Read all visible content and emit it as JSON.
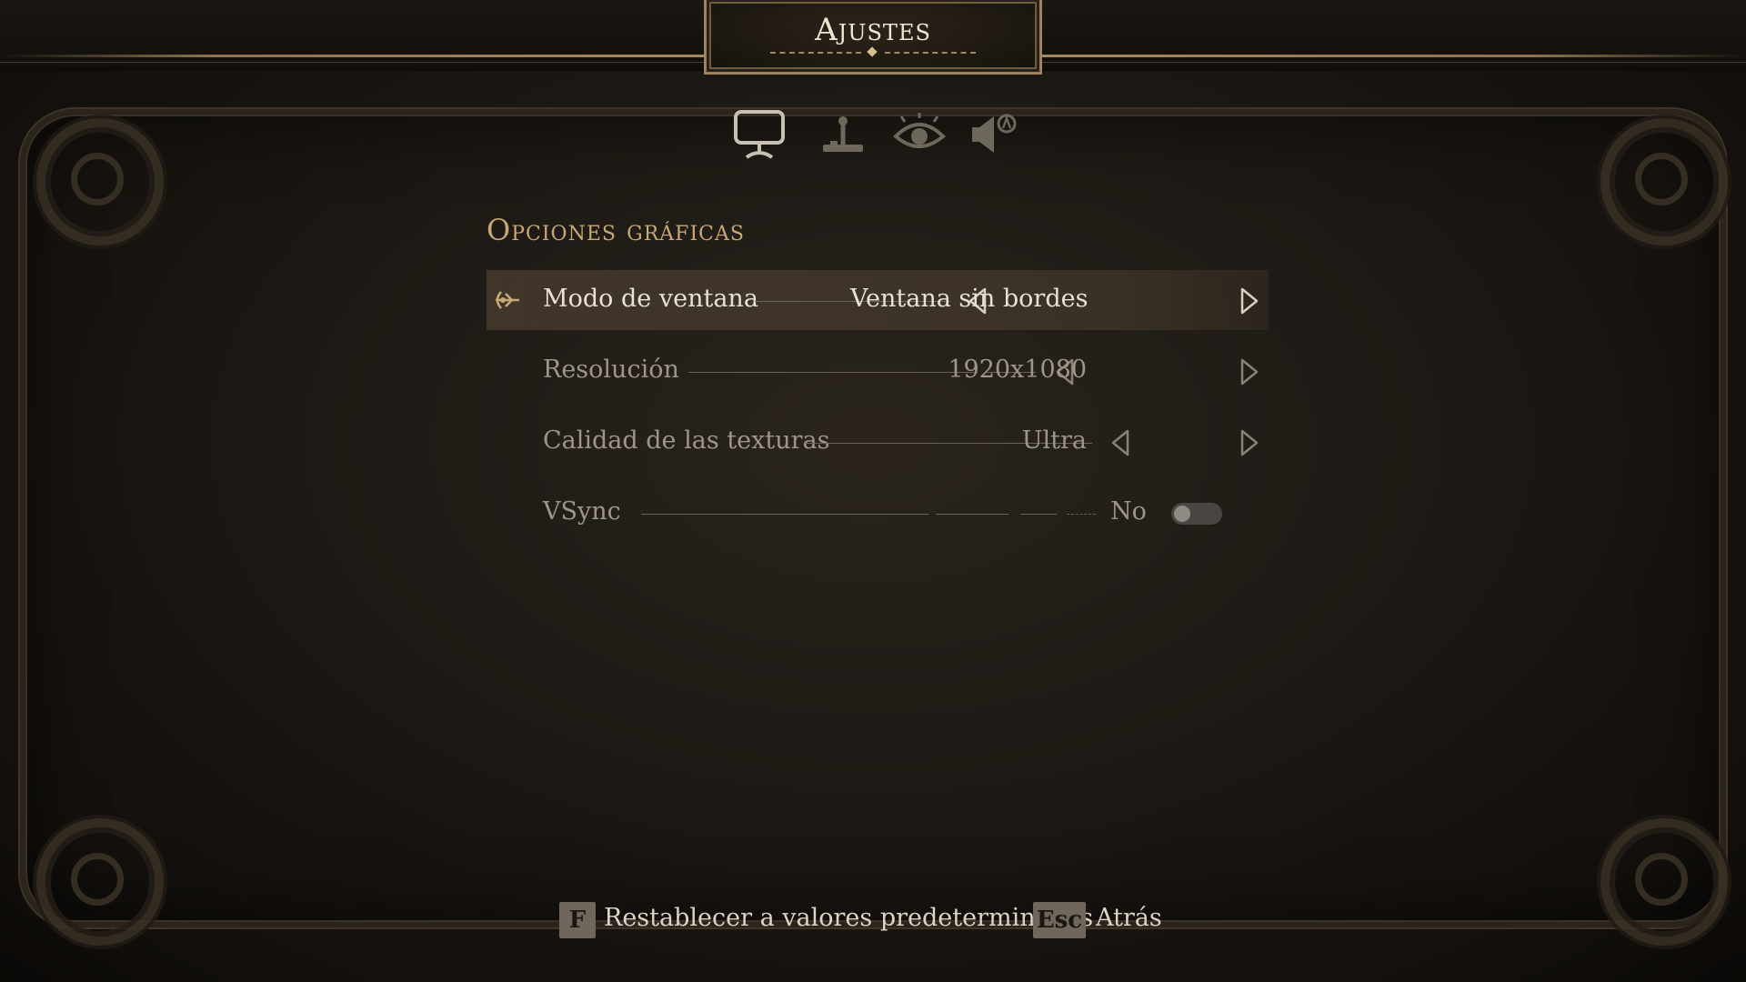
{
  "header": {
    "title": "Ajustes"
  },
  "tabs": [
    {
      "icon": "monitor-icon",
      "active": true
    },
    {
      "icon": "joystick-icon",
      "active": false
    },
    {
      "icon": "eye-icon",
      "active": false
    },
    {
      "icon": "speaker-icon",
      "active": false
    }
  ],
  "section": {
    "title": "Opciones gráficas"
  },
  "settings": [
    {
      "label": "Modo de ventana",
      "value": "Ventana sin bordes",
      "type": "selector",
      "selected": true
    },
    {
      "label": "Resolución",
      "value": "1920x1080",
      "type": "selector",
      "selected": false
    },
    {
      "label": "Calidad de las texturas",
      "value": "Ultra",
      "type": "selector",
      "selected": false
    },
    {
      "label": "VSync",
      "value": "No",
      "type": "toggle",
      "on": false,
      "selected": false
    }
  ],
  "footer": {
    "reset_key": "F",
    "reset_label": "Restablecer a valores predeterminados",
    "back_key": "Esc",
    "back_label": "Atrás"
  },
  "colors": {
    "accent": "#c9a877",
    "text_active": "#e9e2d4",
    "text_inactive": "#9f968a"
  }
}
